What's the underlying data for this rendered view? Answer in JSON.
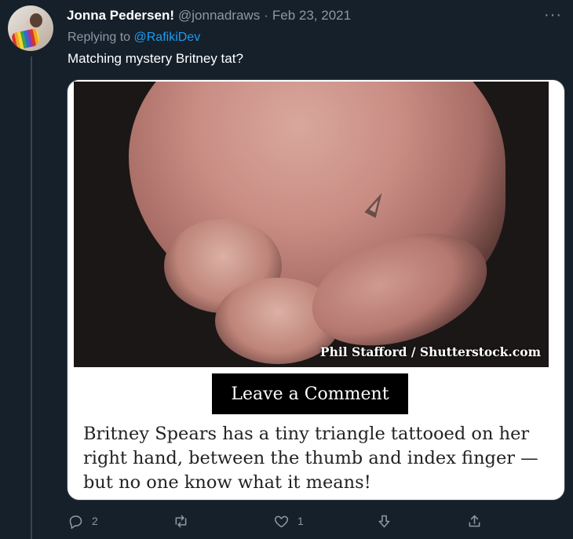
{
  "tweet": {
    "author_name": "Jonna Pedersen!",
    "handle": "@jonnadraws",
    "separator": "·",
    "date": "Feb 23, 2021",
    "more_label": "···",
    "replying_prefix": "Replying to",
    "replying_to": "@RafikiDev",
    "text": "Matching mystery Britney tat?"
  },
  "media": {
    "photo_credit": "Phil Stafford / Shutterstock.com",
    "comment_button": "Leave a Comment",
    "caption": "Britney Spears has a tiny triangle tattooed on her right hand, between the thumb and index finger — but no one know what it means!"
  },
  "actions": {
    "reply_count": "2",
    "retweet_count": "",
    "like_count": "1",
    "icons": [
      "reply-icon",
      "retweet-icon",
      "like-icon",
      "downvote-icon",
      "share-icon"
    ]
  },
  "colors": {
    "background": "#15202b",
    "muted": "#8b98a5",
    "link": "#1d9bf0",
    "border": "#38444d"
  }
}
